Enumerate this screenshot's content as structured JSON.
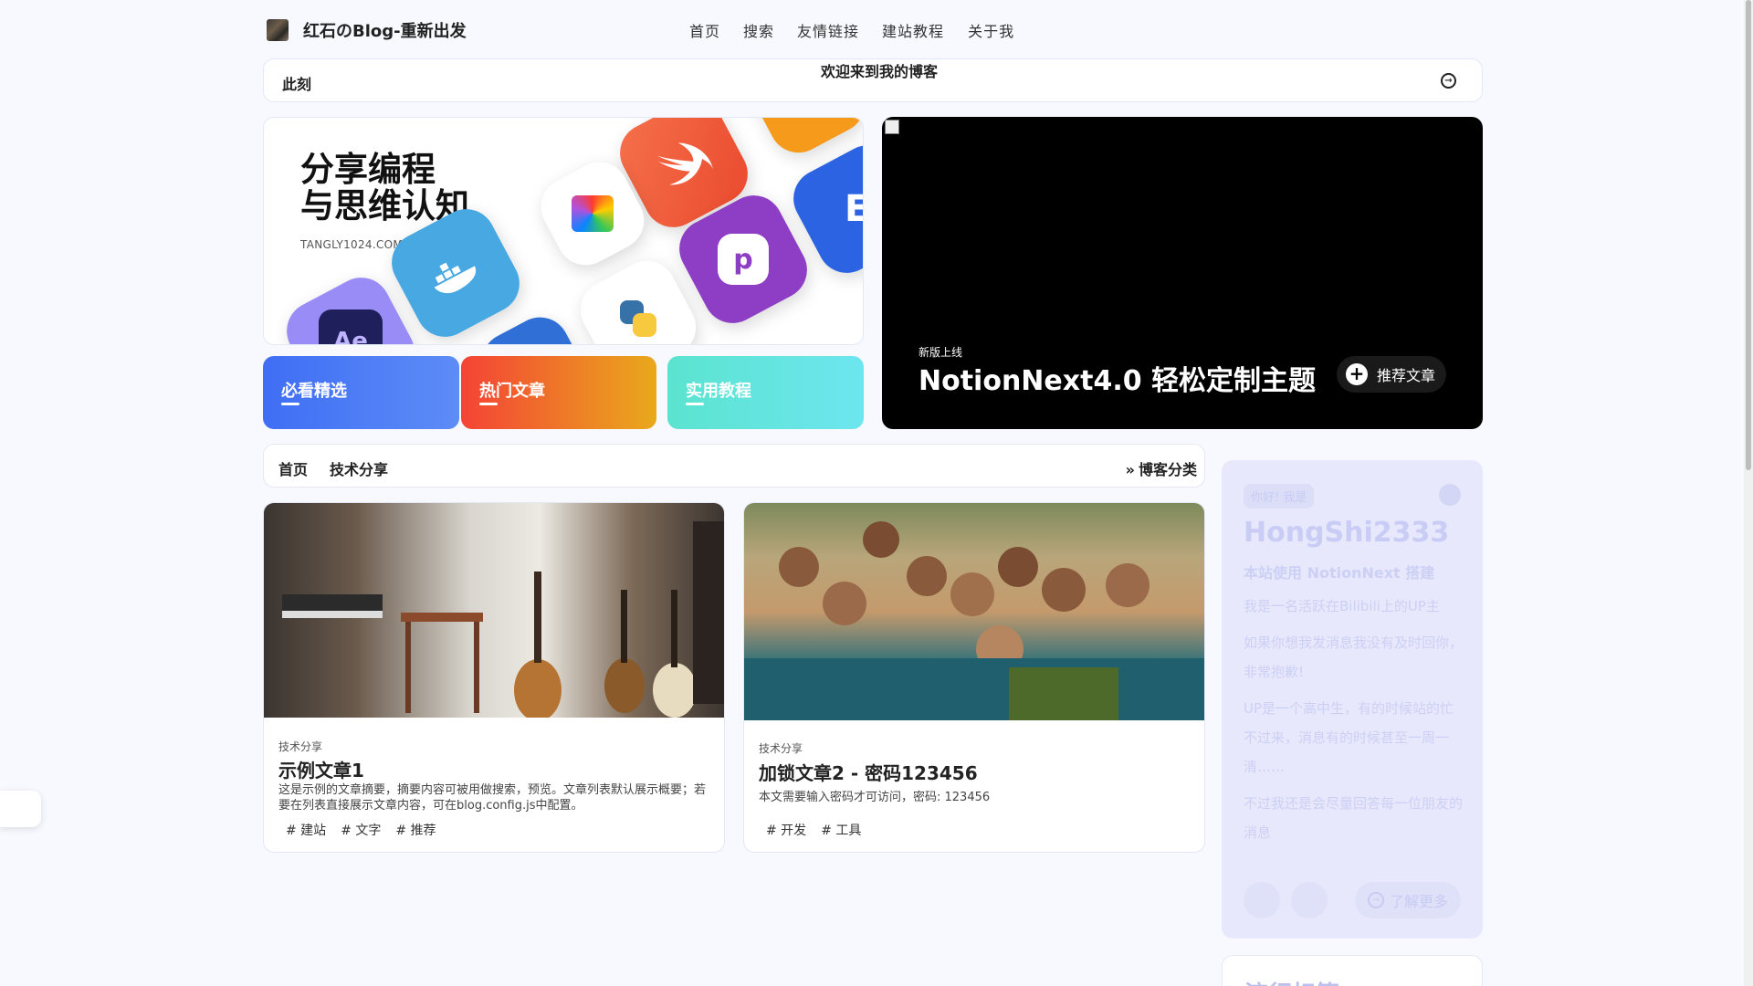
{
  "header": {
    "logo_text": "红石のBlog-重新出发",
    "nav": [
      "首页",
      "搜索",
      "友情链接",
      "建站教程",
      "关于我"
    ],
    "nav_icon_glyph": ""
  },
  "announce": {
    "label": "此刻",
    "text": "欢迎来到我的博客"
  },
  "banner": {
    "title_line1": "分享编程",
    "title_line2": "与思维认知",
    "subtitle": "TANGLY1024.COM"
  },
  "categories": [
    {
      "label": "必看精选",
      "color_from": "#3f6ef5",
      "color_to": "#5d8cf6"
    },
    {
      "label": "热门文章",
      "color_from": "#f44336",
      "color_to": "#e9a91b"
    },
    {
      "label": "实用教程",
      "color_from": "#5be3cf",
      "color_to": "#6de6ef"
    }
  ],
  "featured": {
    "small": "新版上线",
    "title": "NotionNext4.0 轻松定制主题",
    "button": "推荐文章"
  },
  "catbar": {
    "crumb1": "首页",
    "crumb2": "技术分享",
    "more": "博客分类"
  },
  "posts": [
    {
      "category": "技术分享",
      "title": "示例文章1",
      "summary": "这是示例的文章摘要，摘要内容可被用做搜索，预览。文章列表默认展示概要；若要在列表直接展示文章内容，可在blog.config.js中配置。",
      "tags": [
        "# 建站",
        "# 文字",
        "# 推荐"
      ]
    },
    {
      "category": "技术分享",
      "title": "加锁文章2 - 密码123456",
      "summary": "本文需要输入密码才可访问，密码: 123456",
      "tags": [
        "# 开发",
        "# 工具"
      ]
    }
  ],
  "profile": {
    "hello": "你好! 我是",
    "name": "HongShi2333",
    "tagline": "本站使用 NotionNext 搭建",
    "p1": "我是一名活跃在Bilibili上的UP主",
    "p2": "如果你想我发消息我没有及时回你，非常抱歉!",
    "p3": "UP是一个高中生，有的时候站的忙不过来，消息有的时候甚至一周一清……",
    "p4": "不过我还是会尽量回答每一位朋友的消息",
    "learn_more": "了解更多"
  },
  "next_card": {
    "title": "流行标签"
  }
}
